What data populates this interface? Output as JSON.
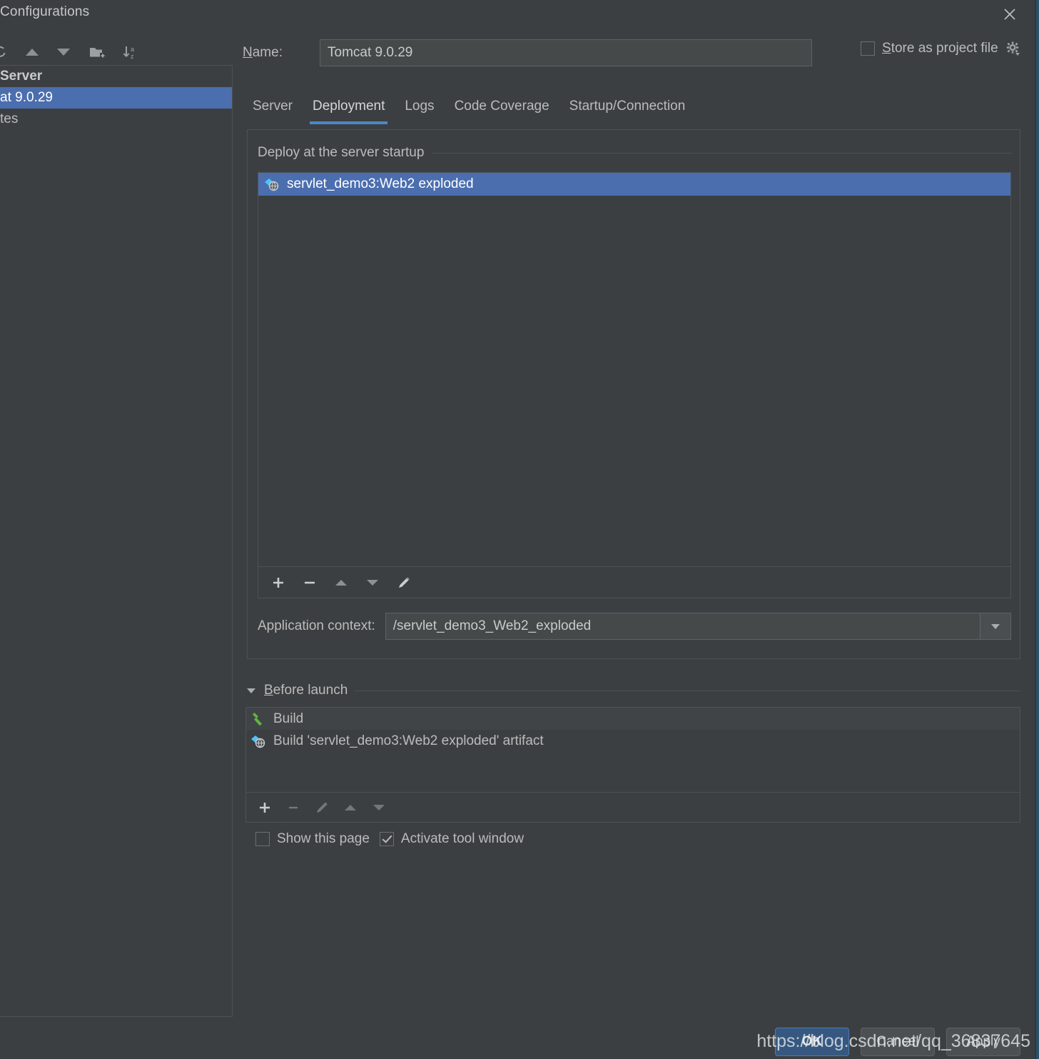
{
  "window": {
    "title": "Configurations",
    "close_icon": "close-icon"
  },
  "sidebar": {
    "toolbar": [
      {
        "name": "copy-configuration-icon",
        "label": "Copy"
      },
      {
        "name": "move-up-icon",
        "label": "Move Up"
      },
      {
        "name": "move-down-icon",
        "label": "Move Down"
      },
      {
        "name": "new-folder-icon",
        "label": "New Folder"
      },
      {
        "name": "sort-alphabetically-icon",
        "label": "Sort Alphabetically"
      }
    ],
    "tree": [
      {
        "label": "Server",
        "type": "group",
        "selected": false
      },
      {
        "label": "at 9.0.29",
        "type": "child",
        "selected": true
      },
      {
        "label": "tes",
        "type": "child",
        "selected": false
      }
    ]
  },
  "form": {
    "name_label": "Name:",
    "name_label_mnemonic": "N",
    "name_label_rest": "ame:",
    "name_value": "Tomcat 9.0.29",
    "store_as_project_file": {
      "label_mnemonic": "S",
      "label_rest": "tore as project file",
      "checked": false,
      "gear_icon": "gear-icon"
    }
  },
  "tabs": [
    {
      "label": "Server",
      "active": false
    },
    {
      "label": "Deployment",
      "active": true
    },
    {
      "label": "Logs",
      "active": false
    },
    {
      "label": "Code Coverage",
      "active": false
    },
    {
      "label": "Startup/Connection",
      "active": false
    }
  ],
  "deployment": {
    "group_label": "Deploy at the server startup",
    "items": [
      {
        "label": "servlet_demo3:Web2 exploded",
        "icon": "artifact-icon",
        "selected": true
      }
    ],
    "toolbar": [
      {
        "name": "add-button",
        "icon": "plus-icon",
        "enabled": true
      },
      {
        "name": "remove-button",
        "icon": "minus-icon",
        "enabled": true
      },
      {
        "name": "move-up-button",
        "icon": "arrow-up-icon",
        "enabled": true
      },
      {
        "name": "move-down-button",
        "icon": "arrow-down-icon",
        "enabled": true
      },
      {
        "name": "edit-button",
        "icon": "pencil-icon",
        "enabled": true
      }
    ],
    "application_context_label": "Application context:",
    "application_context_value": "/servlet_demo3_Web2_exploded"
  },
  "before_launch": {
    "title_mnemonic": "B",
    "title_rest": "efore launch",
    "expanded": true,
    "items": [
      {
        "label": "Build",
        "icon": "build-hammer-icon"
      },
      {
        "label": "Build 'servlet_demo3:Web2 exploded' artifact",
        "icon": "artifact-icon"
      }
    ],
    "toolbar": [
      {
        "name": "add-task-button",
        "icon": "plus-icon",
        "enabled": true
      },
      {
        "name": "remove-task-button",
        "icon": "minus-icon",
        "enabled": false
      },
      {
        "name": "edit-task-button",
        "icon": "pencil-icon",
        "enabled": false
      },
      {
        "name": "task-move-up-button",
        "icon": "arrow-up-icon",
        "enabled": false
      },
      {
        "name": "task-move-down-button",
        "icon": "arrow-down-icon",
        "enabled": false
      }
    ],
    "show_this_page": {
      "label": "Show this page",
      "checked": false
    },
    "activate_tool_window": {
      "label": "Activate tool window",
      "checked": true
    }
  },
  "footer": {
    "ok": "OK",
    "cancel": "Cancel",
    "apply": "Apply",
    "watermark": "https://blog.csdn.net/qq_36837645"
  },
  "colors": {
    "background": "#3C3F41",
    "selection": "#4B6EAF",
    "accent": "#4A88C7",
    "primary_button": "#365880",
    "text": "#BBBBBB",
    "border": "#4E5254"
  }
}
